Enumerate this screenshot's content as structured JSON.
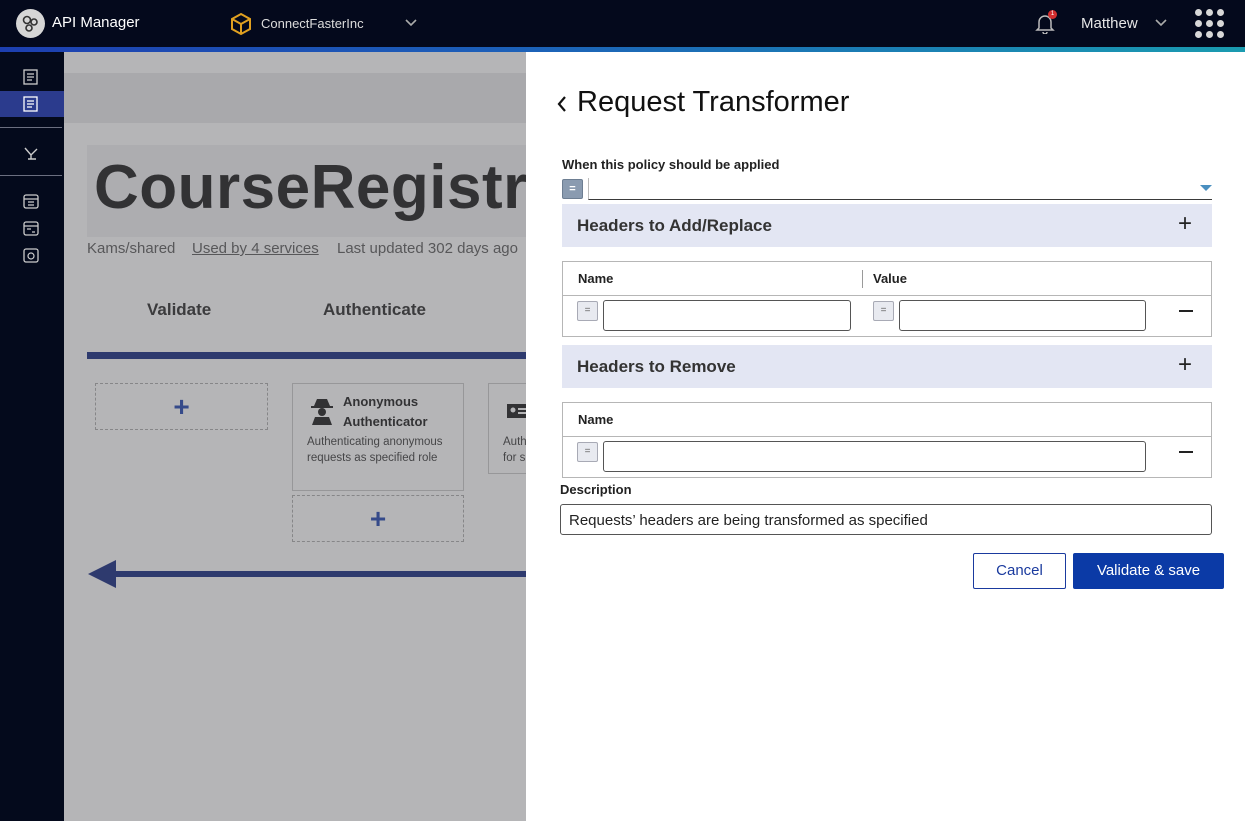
{
  "header": {
    "app_title": "API Manager",
    "org_name": "ConnectFasterInc",
    "notification_count": "1",
    "user_name": "Matthew"
  },
  "sidebar": {
    "items": [
      {
        "icon": "catalog-icon",
        "active": false
      },
      {
        "icon": "policies-icon",
        "active": true
      },
      {
        "icon": "deploy-icon",
        "active": false
      },
      {
        "icon": "calendar-icon",
        "active": false
      },
      {
        "icon": "calendar-alt-icon",
        "active": false
      },
      {
        "icon": "box-icon",
        "active": false
      }
    ]
  },
  "background": {
    "api_title": "CourseRegistra",
    "owner": "Kams/shared",
    "used_by": "Used by 4 services",
    "last_updated": "Last updated 302 days ago",
    "tabs": [
      "Validate",
      "Authenticate"
    ],
    "card": {
      "title": "Anonymous Authenticator",
      "description": "Authenticating anonymous requests as specified role"
    },
    "card2_fragment": "Auth\nfor s",
    "add_symbol": "+"
  },
  "panel": {
    "title": "Request Transformer",
    "condition_label": "When this policy should be applied",
    "condition_value": "",
    "condition_btn": "=",
    "add_replace_section": {
      "label": "Headers to Add/Replace",
      "columns": [
        "Name",
        "Value"
      ],
      "rows": [
        {
          "name": "",
          "value": ""
        }
      ]
    },
    "remove_section": {
      "label": "Headers to Remove",
      "columns": [
        "Name"
      ],
      "rows": [
        {
          "name": ""
        }
      ]
    },
    "description_label": "Description",
    "description_value": "Requests’ headers are being transformed as specified",
    "cancel_label": "Cancel",
    "save_label": "Validate & save",
    "plus_symbol": "+",
    "field_btn": "="
  },
  "colors": {
    "topbar": "#04091c",
    "accent": "#0b3aa6",
    "section_bg": "#e3e6f3"
  }
}
